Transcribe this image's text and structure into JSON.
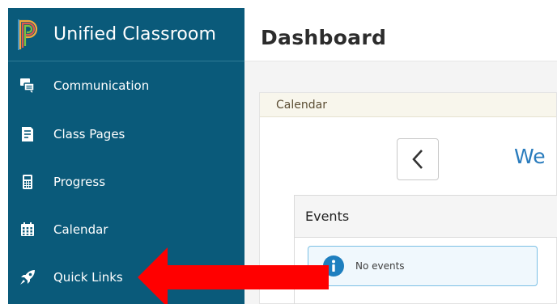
{
  "sidebar": {
    "app_title": "Unified Classroom",
    "logo_icon": "powerschool-logo-icon",
    "items": [
      {
        "label": "Communication",
        "icon": "chat-bubbles-icon"
      },
      {
        "label": "Class Pages",
        "icon": "document-lines-icon"
      },
      {
        "label": "Progress",
        "icon": "calculator-icon"
      },
      {
        "label": "Calendar",
        "icon": "calendar-grid-icon"
      },
      {
        "label": "Quick Links",
        "icon": "rocket-icon"
      }
    ]
  },
  "main": {
    "title": "Dashboard",
    "calendar": {
      "header": "Calendar",
      "prev_icon": "chevron-left-icon",
      "week_label": "We",
      "events": {
        "title": "Events",
        "empty_message": "No events",
        "alert_icon": "info-icon"
      }
    }
  },
  "annotation": {
    "type": "red-arrow",
    "color": "#ff0000",
    "points_to": "Quick Links"
  },
  "colors": {
    "sidebar_bg": "#0a5a7a",
    "accent_blue": "#2a7cbd",
    "calendar_header_bg": "#f8f6ec",
    "alert_border": "#7cc0e5"
  }
}
